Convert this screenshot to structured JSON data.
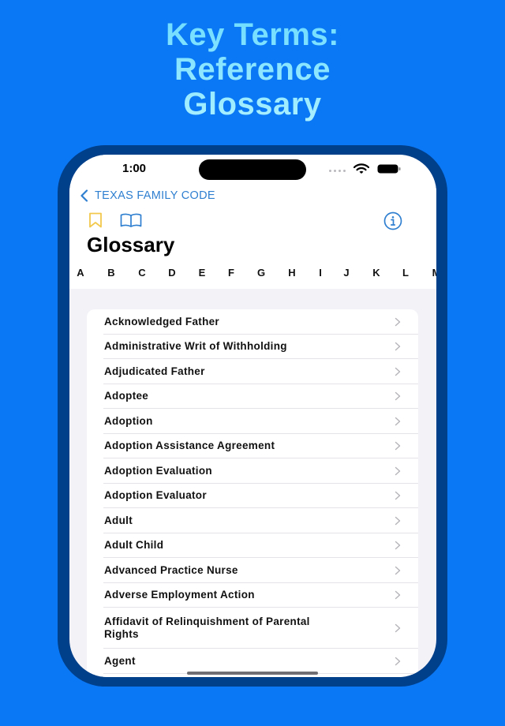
{
  "promo": {
    "title_lines": [
      "Key Terms:",
      "Reference",
      "Glossary"
    ]
  },
  "status_bar": {
    "time": "1:00",
    "icons": [
      "cellular-dots-icon",
      "wifi-icon",
      "battery-icon"
    ]
  },
  "nav": {
    "back_label": "TEXAS FAMILY CODE",
    "back_icon": "chevron-left-icon"
  },
  "toolbar": {
    "left_icons": [
      "bookmark-icon",
      "book-open-icon"
    ],
    "right_icons": [
      "info-circle-icon"
    ]
  },
  "page": {
    "title": "Glossary"
  },
  "alphabet_index": [
    "A",
    "B",
    "C",
    "D",
    "E",
    "F",
    "G",
    "H",
    "I",
    "J",
    "K",
    "L",
    "M"
  ],
  "glossary": {
    "terms": [
      "Acknowledged Father",
      "Administrative Writ of Withholding",
      "Adjudicated Father",
      "Adoptee",
      "Adoption",
      "Adoption Assistance Agreement",
      "Adoption Evaluation",
      "Adoption Evaluator",
      "Adult",
      "Adult Child",
      "Advanced Practice Nurse",
      "Adverse Employment Action",
      "Affidavit of Relinquishment of Parental Rights",
      "Agent"
    ]
  },
  "colors": {
    "background": "#0a77f4",
    "frame": "#003f8a",
    "accent": "#2f7fd0",
    "bookmark": "#f2c94c",
    "title_gradient_top": "#6fdcff",
    "title_gradient_bottom": "#a9f0ff"
  }
}
